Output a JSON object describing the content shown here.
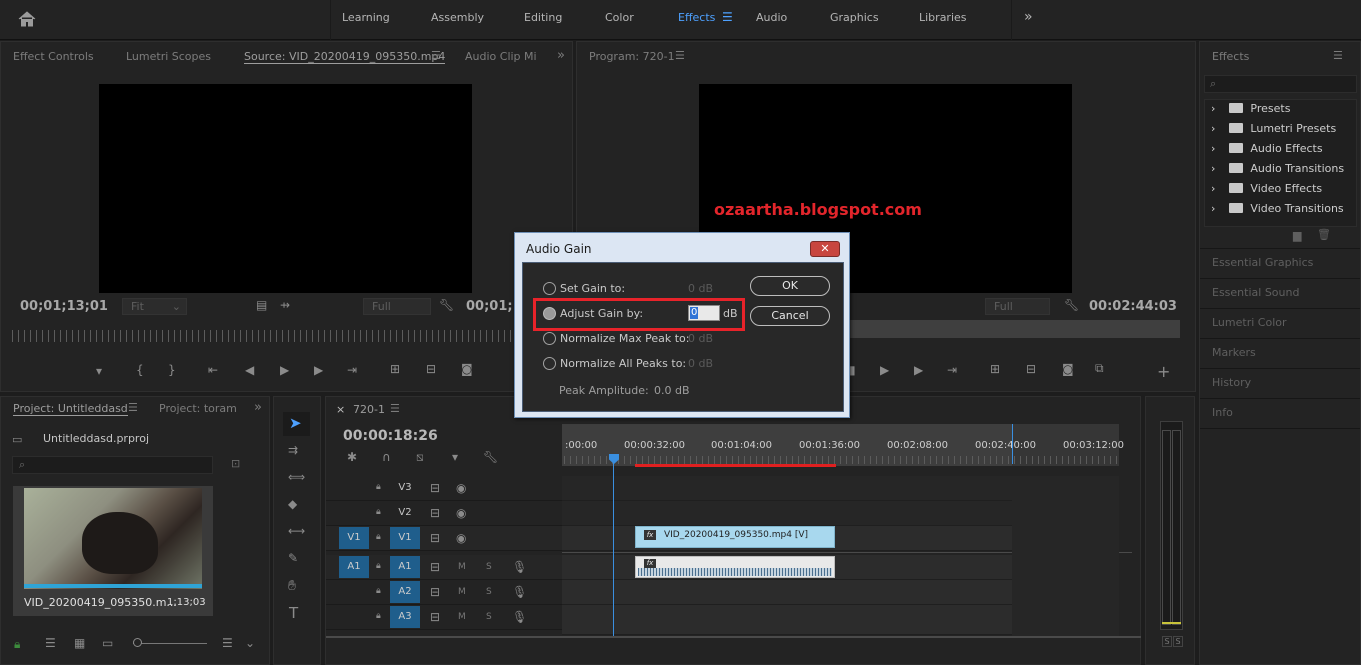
{
  "workspaces": [
    "Learning",
    "Assembly",
    "Editing",
    "Color",
    "Effects",
    "Audio",
    "Graphics",
    "Libraries"
  ],
  "active_workspace": "Effects",
  "accent_color": "#4ea1ff",
  "source_panel": {
    "tabs": [
      "Effect Controls",
      "Lumetri Scopes",
      "Source: VID_20200419_095350.mp4",
      "Audio Clip Mi"
    ],
    "timecode_left": "00;01;13;01",
    "timecode_right": "00;01;1",
    "fit_label": "Fit",
    "full_label": "Full"
  },
  "program_panel": {
    "tab": "Program: 720-1",
    "timecode_right": "00:02:44:03",
    "full_label": "Full"
  },
  "watermark": "ozaartha.blogspot.com",
  "effects_panel": {
    "title": "Effects",
    "items": [
      "Presets",
      "Lumetri Presets",
      "Audio Effects",
      "Audio Transitions",
      "Video Effects",
      "Video Transitions"
    ],
    "sections": [
      "Essential Graphics",
      "Essential Sound",
      "Lumetri Color",
      "Markers",
      "History",
      "Info"
    ]
  },
  "project_panel": {
    "tabs": [
      "Project: Untitleddasd",
      "Project: toram"
    ],
    "file": "Untitleddasd.prproj",
    "clip_name": "VID_20200419_095350.m...",
    "clip_duration": "1;13;03"
  },
  "timeline": {
    "sequence": "720-1",
    "timecode": "00:00:18:26",
    "ruler": [
      ":00:00",
      "00:00:32:00",
      "00:01:04:00",
      "00:01:36:00",
      "00:02:08:00",
      "00:02:40:00",
      "00:03:12:00"
    ],
    "tracks": [
      {
        "name": "V3",
        "source": ""
      },
      {
        "name": "V2",
        "source": ""
      },
      {
        "name": "V1",
        "source": "V1"
      },
      {
        "name": "A1",
        "source": "A1"
      },
      {
        "name": "A2",
        "source": ""
      },
      {
        "name": "A3",
        "source": ""
      }
    ],
    "mute_label": "M",
    "solo_label": "S",
    "video_clip": "VID_20200419_095350.mp4 [V]",
    "fx_badge": "fx"
  },
  "meter": {
    "solo_labels": [
      "S",
      "S"
    ]
  },
  "dialog": {
    "title": "Audio Gain",
    "close_label": "✕",
    "options": [
      {
        "label": "Set Gain to:",
        "value": "0 dB",
        "selected": false
      },
      {
        "label": "Adjust Gain by:",
        "value": "0",
        "unit": "dB",
        "selected": true
      },
      {
        "label": "Normalize Max Peak to:",
        "value": "0 dB",
        "selected": false
      },
      {
        "label": "Normalize All Peaks to:",
        "value": "0 dB",
        "selected": false
      }
    ],
    "peak_label": "Peak Amplitude:",
    "peak_value": "0.0 dB",
    "ok_label": "OK",
    "cancel_label": "Cancel"
  }
}
